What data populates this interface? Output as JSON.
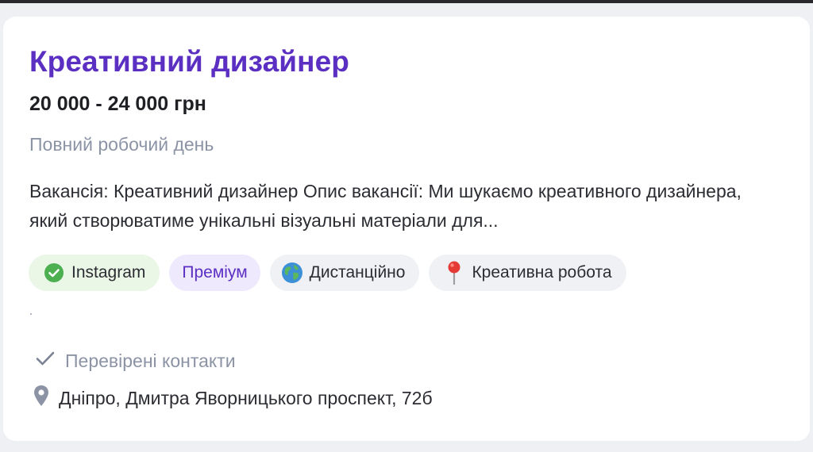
{
  "job": {
    "title": "Креативний дизайнер",
    "salary": "20 000 - 24 000 грн",
    "schedule": "Повний робочий день",
    "description": "Вакансія: Креативний дизайнер Опис вакансії: Ми шукаємо креативного дизайнера, який створюватиме унікальні візуальні матеріали для..."
  },
  "tags": {
    "instagram": "Instagram",
    "premium": "Преміум",
    "remote": "Дистанційно",
    "creative": "Креативна робота"
  },
  "footer": {
    "verified": "Перевірені контакти",
    "address": "Дніпро, Дмитра Яворницького проспект, 72б"
  },
  "colors": {
    "accent": "#5a2fc2",
    "verified_green": "#4caf50",
    "muted": "#8b93a5",
    "pin": "#e53935"
  },
  "icons": {
    "instagram": "check-circle-icon",
    "remote": "globe-icon",
    "creative": "pushpin-icon",
    "verified": "checkmark-icon",
    "address": "location-pin-icon"
  }
}
